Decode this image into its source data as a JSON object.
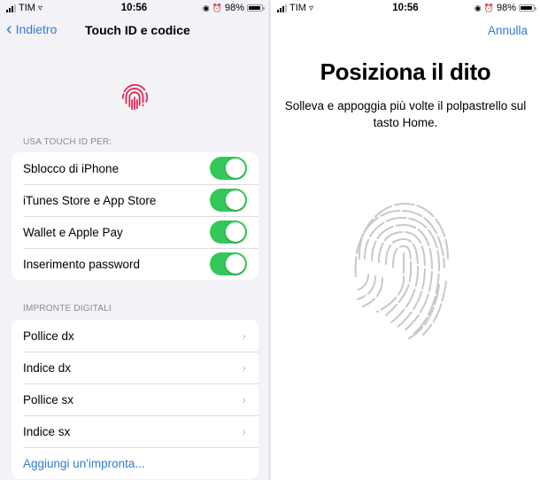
{
  "left_screen": {
    "status_bar": {
      "carrier": "TIM",
      "time": "10:56",
      "battery": "98%",
      "battery_level": 0.98
    },
    "nav": {
      "back_label": "Indietro",
      "title": "Touch ID e codice"
    },
    "icon": "fingerprint-icon",
    "accent_color": "#e8204a",
    "touch_id_section": {
      "header": "USA TOUCH ID PER:",
      "items": [
        {
          "label": "Sblocco di iPhone",
          "on": true
        },
        {
          "label": "iTunes Store e App Store",
          "on": true
        },
        {
          "label": "Wallet e Apple Pay",
          "on": true
        },
        {
          "label": "Inserimento password",
          "on": true
        }
      ]
    },
    "fingerprints_section": {
      "header": "IMPRONTE DIGITALI",
      "items": [
        {
          "label": "Pollice dx"
        },
        {
          "label": "Indice dx"
        },
        {
          "label": "Pollice sx"
        },
        {
          "label": "Indice sx"
        }
      ],
      "add_label": "Aggiungi un'impronta..."
    }
  },
  "right_screen": {
    "status_bar": {
      "carrier": "TIM",
      "time": "10:56",
      "battery": "98%",
      "battery_level": 0.98
    },
    "cancel_label": "Annulla",
    "title": "Posiziona il dito",
    "instructions": "Solleva e appoggia più volte il polpastrello sul tasto Home.",
    "icon": "fingerprint-icon"
  },
  "colors": {
    "link": "#2f7bd6",
    "toggle_on": "#34c759",
    "fingerprint_red": "#e8204a",
    "fingerprint_gray": "#c8c8c8"
  }
}
